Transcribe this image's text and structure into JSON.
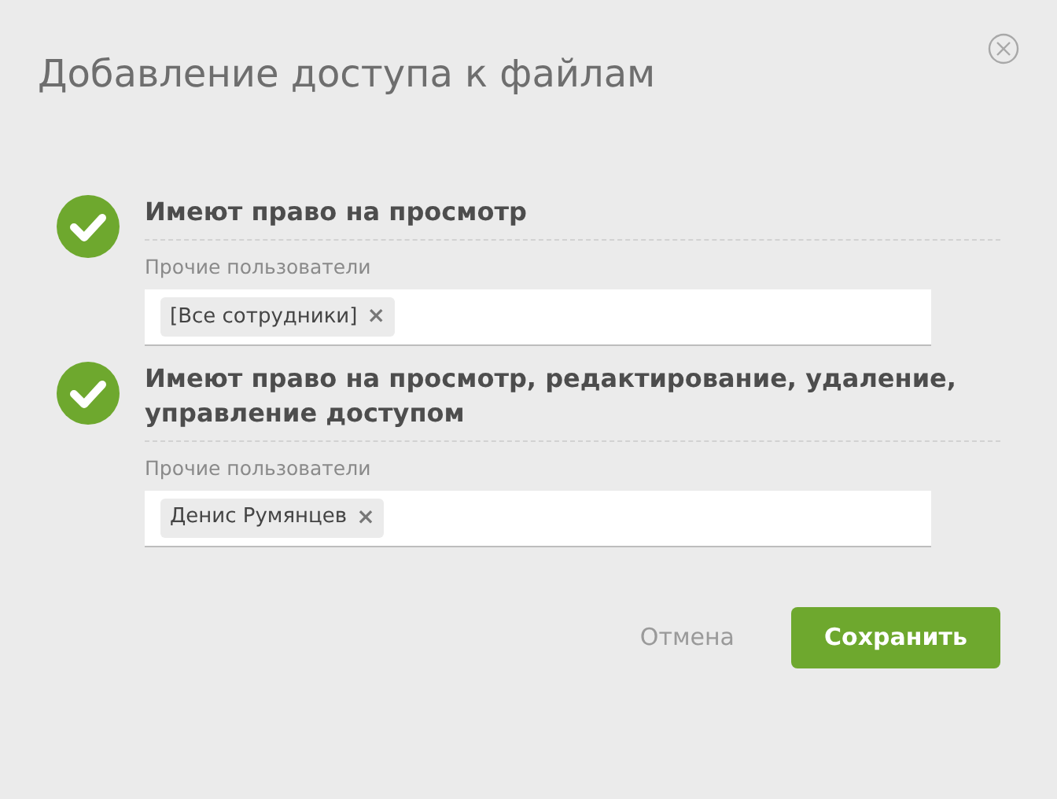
{
  "dialog": {
    "title": "Добавление доступа к файлам"
  },
  "sections": [
    {
      "checked": true,
      "heading": "Имеют право на просмотр",
      "field_label": "Прочие пользователи",
      "tags": [
        {
          "label": "[Все сотрудники]",
          "remove": "×"
        }
      ]
    },
    {
      "checked": true,
      "heading": "Имеют право на просмотр, редактирование, удаление, управление доступом",
      "field_label": "Прочие пользователи",
      "tags": [
        {
          "label": "Денис Румянцев",
          "remove": "×"
        }
      ]
    }
  ],
  "buttons": [
    {
      "kind": "link",
      "label": "Отмена"
    },
    {
      "kind": "primary",
      "label": "Сохранить"
    }
  ]
}
